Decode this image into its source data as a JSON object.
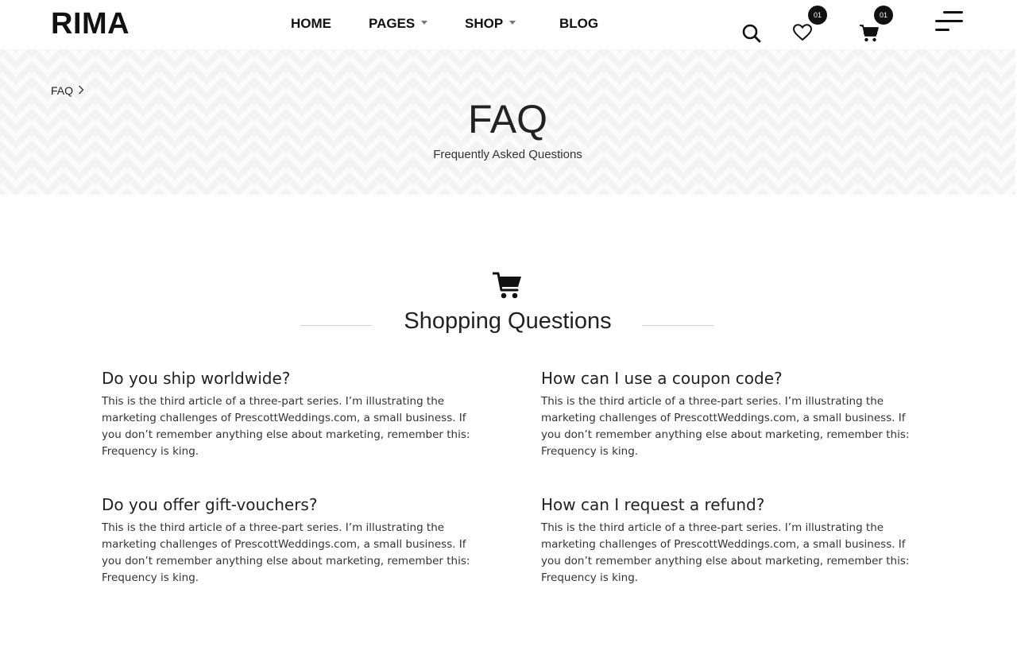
{
  "header": {
    "logo": "RIMA",
    "nav": [
      {
        "label": "HOME",
        "has_dropdown": false
      },
      {
        "label": "PAGES",
        "has_dropdown": true
      },
      {
        "label": "SHOP",
        "has_dropdown": true
      },
      {
        "label": "BLOG",
        "has_dropdown": false
      }
    ],
    "icons": {
      "search": "search-icon",
      "wishlist": "heart-icon",
      "cart": "cart-icon",
      "menu": "menu-icon"
    },
    "wishlist_count": "01",
    "cart_count": "01"
  },
  "hero": {
    "breadcrumb": "FAQ",
    "title": "FAQ",
    "subtitle": "Frequently Asked Questions"
  },
  "section": {
    "icon": "cart-icon",
    "title": "Shopping Questions"
  },
  "faqs": [
    {
      "question": "Do you ship worldwide?",
      "answer": "This is the third article of a three-part series. I’m illustrating the marketing challenges of PrescottWeddings.com, a small business. If you don’t remember anything else about marketing, remember this: Frequency is king."
    },
    {
      "question": "How can I use a coupon code?",
      "answer": "This is the third article of a three-part series. I’m illustrating the marketing challenges of PrescottWeddings.com, a small business. If you don’t remember anything else about marketing, remember this: Frequency is king."
    },
    {
      "question": "Do you offer gift-vouchers?",
      "answer": "This is the third article of a three-part series. I’m illustrating the marketing challenges of PrescottWeddings.com, a small business. If you don’t remember anything else about marketing, remember this: Frequency is king."
    },
    {
      "question": "How can I request a refund?",
      "answer": "This is the third article of a three-part series. I’m illustrating the marketing challenges of PrescottWeddings.com, a small business. If you don’t remember anything else about marketing, remember this: Frequency is king."
    }
  ],
  "colors": {
    "text": "#111111",
    "hero_bg": "#f3f3f3",
    "badge_bg": "#111111"
  }
}
